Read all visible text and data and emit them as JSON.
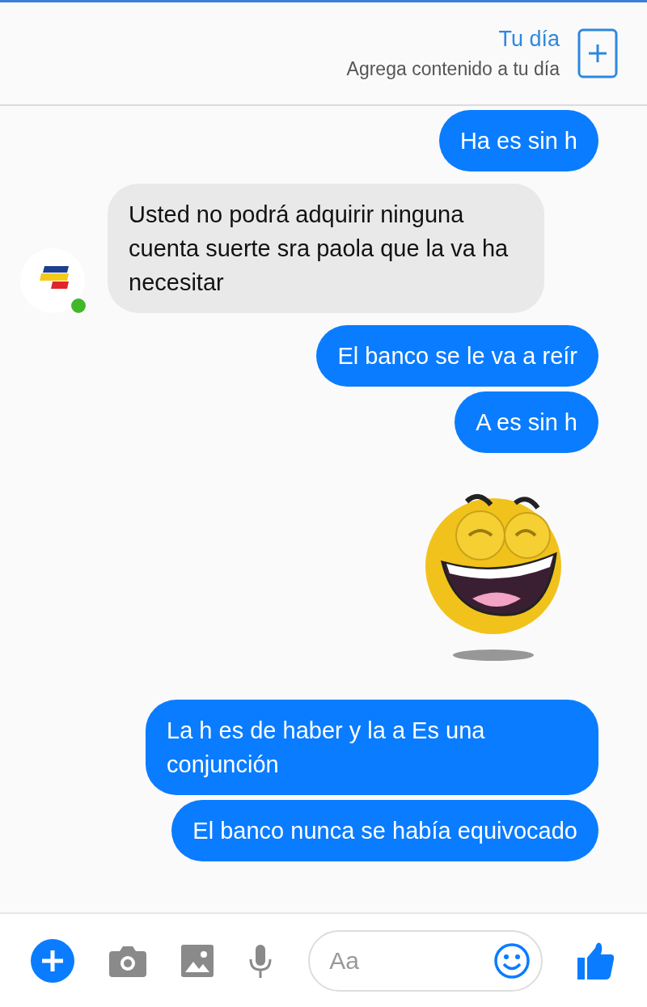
{
  "header": {
    "title": "Tu día",
    "subtitle": "Agrega contenido a tu día"
  },
  "messages": [
    {
      "kind": "sent",
      "text": "Ha es sin h"
    },
    {
      "kind": "received",
      "text": "Usted no podrá adquirir ninguna cuenta suerte sra paola que la va ha necesitar",
      "online": true
    },
    {
      "kind": "sent",
      "text": "El banco se le va a reír"
    },
    {
      "kind": "sent",
      "text": "A es sin h"
    },
    {
      "kind": "sticker"
    },
    {
      "kind": "sent",
      "text": "La h es de haber y la a Es una conjunción"
    },
    {
      "kind": "sent",
      "text": "El banco nunca se había equivocado"
    }
  ],
  "composer": {
    "placeholder": "Aa"
  }
}
